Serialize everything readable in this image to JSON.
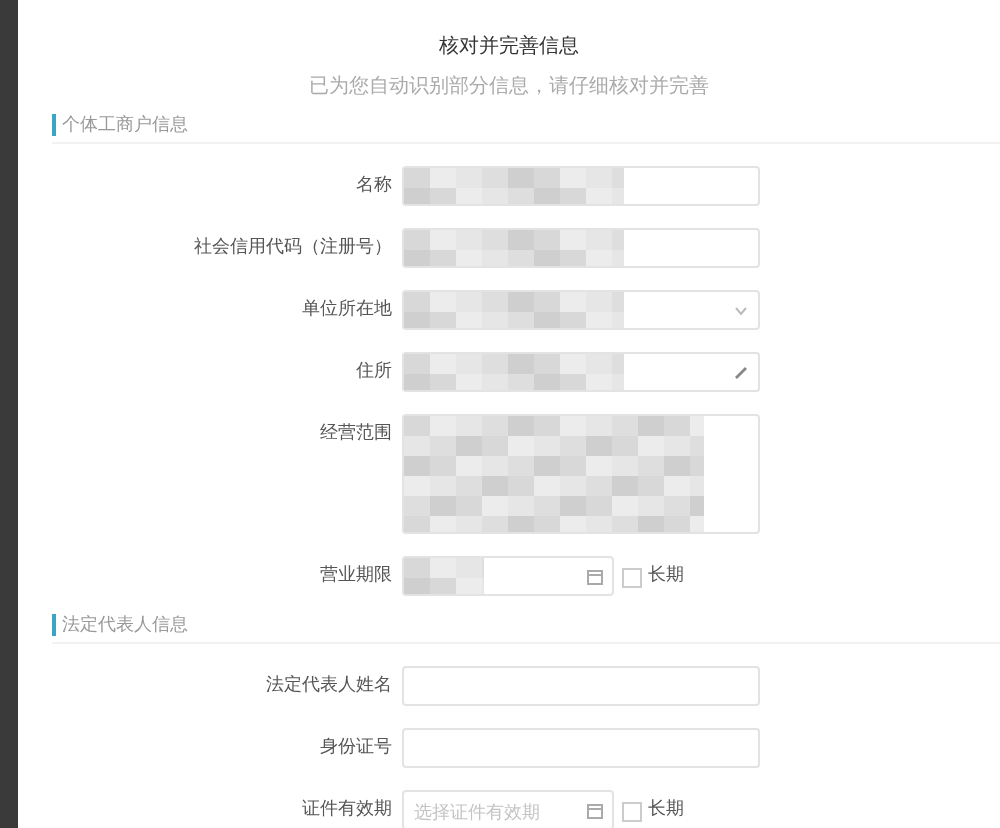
{
  "dialog": {
    "title": "核对并完善信息",
    "subtitle": "已为您自动识别部分信息，请仔细核对并完善"
  },
  "sections": [
    {
      "heading": "个体工商户信息",
      "fields": [
        {
          "label": "名称",
          "kind": "text",
          "masked": true
        },
        {
          "label": "社会信用代码（注册号）",
          "kind": "text",
          "masked": true
        },
        {
          "label": "单位所在地",
          "kind": "select",
          "masked": true
        },
        {
          "label": "住所",
          "kind": "address",
          "masked": true
        },
        {
          "label": "经营范围",
          "kind": "textarea",
          "masked": true
        },
        {
          "label": "营业期限",
          "kind": "date",
          "masked": true,
          "checkbox": {
            "label": "长期",
            "checked": false
          }
        }
      ]
    },
    {
      "heading": "法定代表人信息",
      "fields": [
        {
          "label": "法定代表人姓名",
          "kind": "text",
          "masked": false
        },
        {
          "label": "身份证号",
          "kind": "text",
          "masked": false
        },
        {
          "label": "证件有效期",
          "kind": "date",
          "masked": false,
          "placeholder": "选择证件有效期",
          "checkbox": {
            "label": "长期",
            "checked": false
          }
        }
      ]
    }
  ]
}
